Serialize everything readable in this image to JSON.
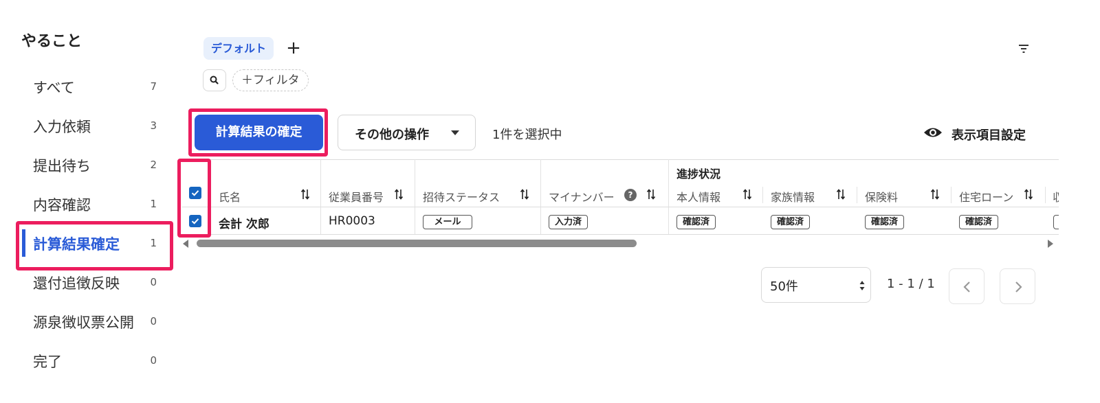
{
  "sidebar": {
    "title": "やること",
    "items": [
      {
        "label": "すべて",
        "count": "7"
      },
      {
        "label": "入力依頼",
        "count": "3"
      },
      {
        "label": "提出待ち",
        "count": "2"
      },
      {
        "label": "内容確認",
        "count": "1"
      },
      {
        "label": "計算結果確定",
        "count": "1"
      },
      {
        "label": "還付追徴反映",
        "count": "0"
      },
      {
        "label": "源泉徴収票公開",
        "count": "0"
      },
      {
        "label": "完了",
        "count": "0"
      }
    ],
    "active_index": 4
  },
  "tabs": {
    "default_label": "デフォルト",
    "add_label": "+"
  },
  "filter": {
    "add_filter_label": "＋フィルタ"
  },
  "actions": {
    "confirm_label": "計算結果の確定",
    "other_label": "その他の操作",
    "selected_text": "1件を選択中",
    "display_settings_label": "表示項目設定"
  },
  "table": {
    "group_header": "進捗状況",
    "headers": {
      "name": "氏名",
      "employee_no": "従業員番号",
      "invite_status": "招待ステータス",
      "my_number": "マイナンバー",
      "self_info": "本人情報",
      "family_info": "家族情報",
      "insurance": "保険料",
      "housing_loan": "住宅ローン",
      "next": "収"
    },
    "rows": [
      {
        "selected": true,
        "name": "会計 次郎",
        "employee_no": "HR0003",
        "invite_status": "メール",
        "my_number": "入力済",
        "self_info": "確認済",
        "family_info": "確認済",
        "insurance": "確認済",
        "housing_loan": "確認済"
      }
    ]
  },
  "pagination": {
    "per_page": "50件",
    "range": "1 - 1 / 1"
  },
  "colors": {
    "primary": "#2a5bd7",
    "highlight": "#ec1d5e",
    "checkbox": "#1565c0"
  }
}
